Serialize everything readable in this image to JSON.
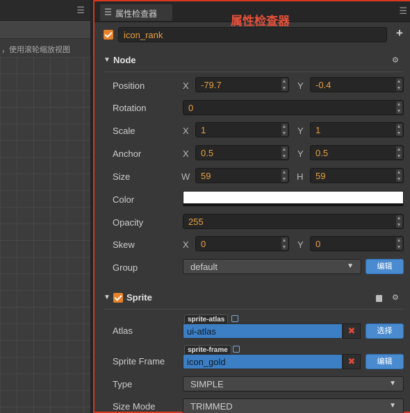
{
  "scene_panel": {
    "menu_icon": "hamburger-menu-icon",
    "hint": "，使用滚轮缩放视图"
  },
  "inspector": {
    "tab_label": "属性检查器",
    "title_annotation": "属性检查器",
    "menu_icon": "hamburger-menu-icon",
    "node_name": "icon_rank",
    "add_component_icon": "plus-icon",
    "accent_color": "#e8822a",
    "value_color": "#e8a040",
    "highlight_color": "#d9381e"
  },
  "node": {
    "title": "Node",
    "rows": {
      "position": {
        "label": "Position",
        "x_axis": "X",
        "x": "-79.7",
        "y_axis": "Y",
        "y": "-0.4"
      },
      "rotation": {
        "label": "Rotation",
        "value": "0"
      },
      "scale": {
        "label": "Scale",
        "x_axis": "X",
        "x": "1",
        "y_axis": "Y",
        "y": "1"
      },
      "anchor": {
        "label": "Anchor",
        "x_axis": "X",
        "x": "0.5",
        "y_axis": "Y",
        "y": "0.5"
      },
      "size": {
        "label": "Size",
        "w_axis": "W",
        "w": "59",
        "h_axis": "H",
        "h": "59"
      },
      "color": {
        "label": "Color",
        "value": "#ffffff"
      },
      "opacity": {
        "label": "Opacity",
        "value": "255"
      },
      "skew": {
        "label": "Skew",
        "x_axis": "X",
        "x": "0",
        "y_axis": "Y",
        "y": "0"
      },
      "group": {
        "label": "Group",
        "value": "default",
        "button": "编辑"
      }
    }
  },
  "sprite": {
    "title": "Sprite",
    "atlas": {
      "label": "Atlas",
      "tag": "sprite-atlas",
      "value": "ui-atlas",
      "button": "选择"
    },
    "sprite_frame": {
      "label": "Sprite Frame",
      "tag": "sprite-frame",
      "value": "icon_gold",
      "button": "编辑"
    },
    "type": {
      "label": "Type",
      "value": "SIMPLE"
    },
    "size_mode": {
      "label": "Size Mode",
      "value": "TRIMMED"
    }
  }
}
